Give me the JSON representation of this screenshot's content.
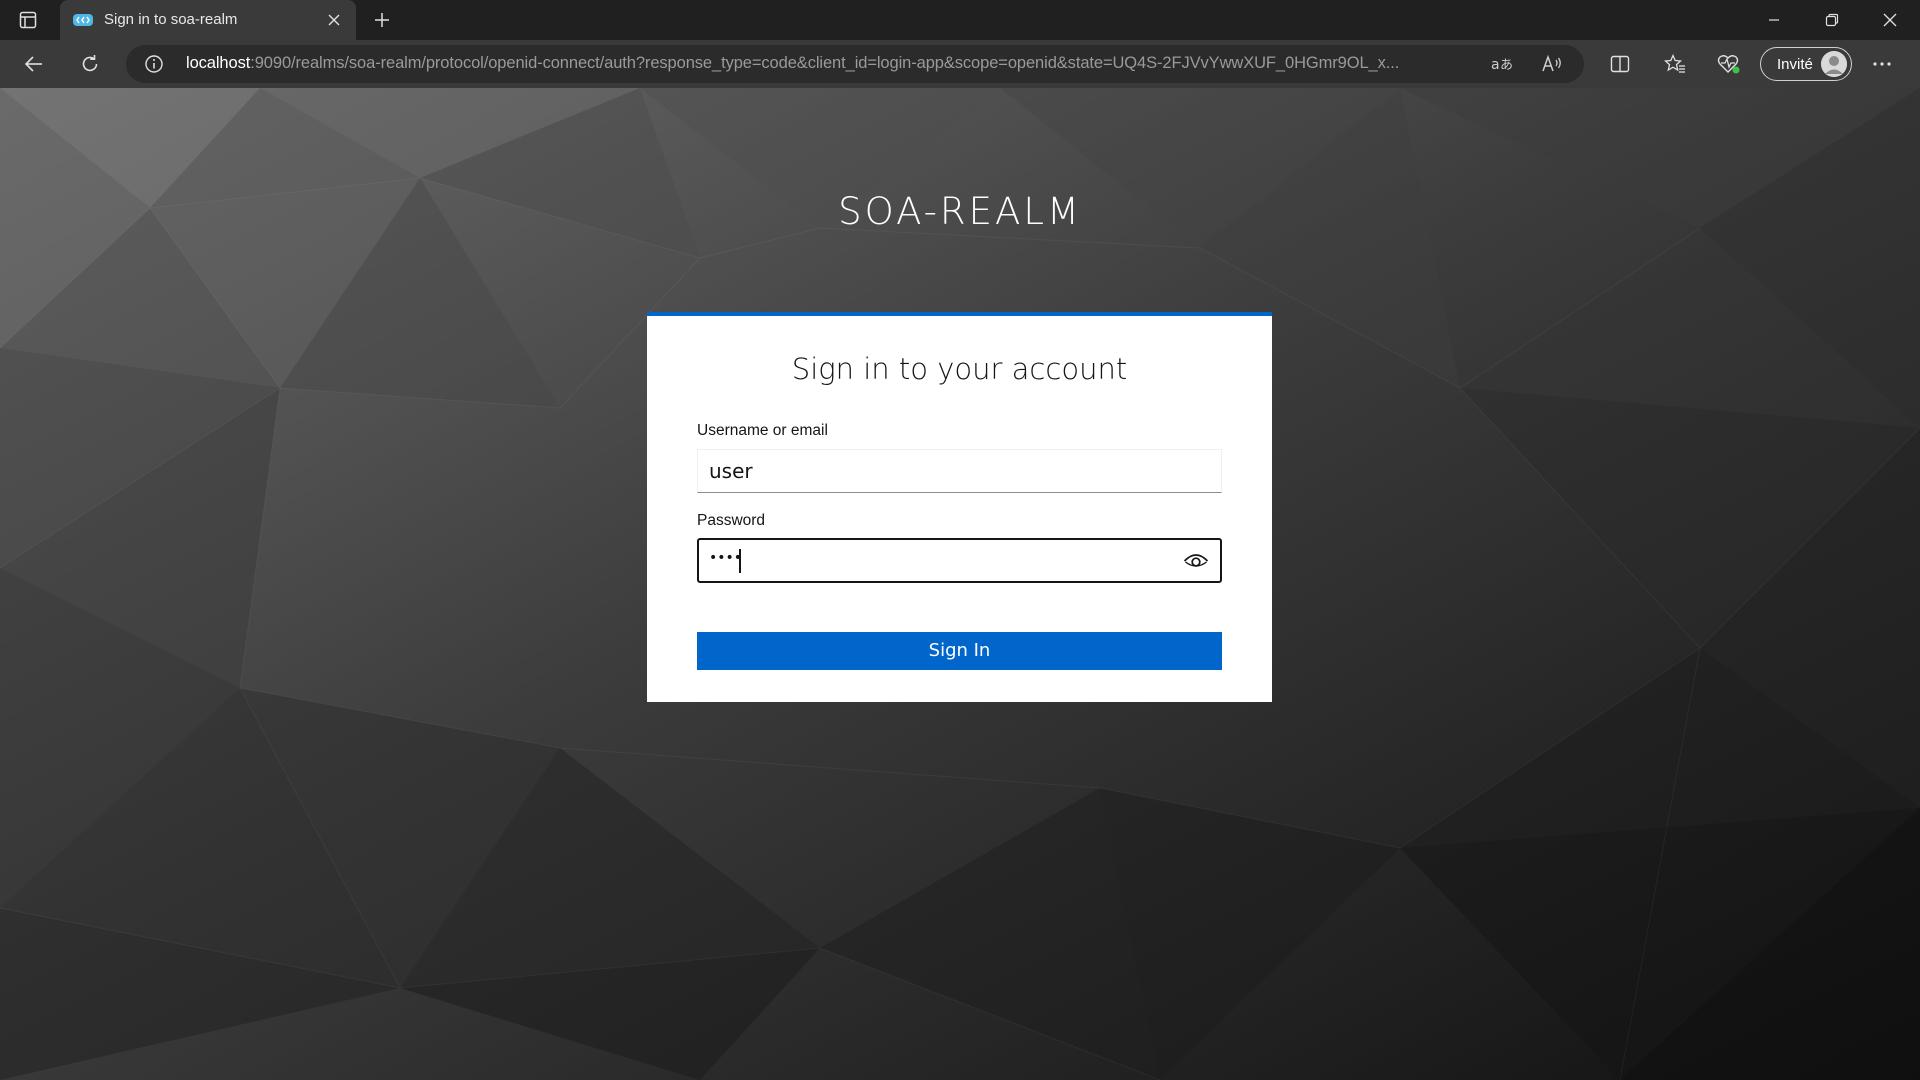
{
  "browser": {
    "tab": {
      "title": "Sign in to soa-realm"
    },
    "address_bar": {
      "url_host": "localhost",
      "url_rest": ":9090/realms/soa-realm/protocol/openid-connect/auth?response_type=code&client_id=login-app&scope=openid&state=UQ4S-2FJVvYwwXUF_0HGmr9OL_x..."
    },
    "profile": {
      "label": "Invité"
    },
    "icons": [
      "tab-actions-icon",
      "browser-favicon",
      "close-icon",
      "plus-icon",
      "minimize-icon",
      "restore-icon",
      "window-close-icon",
      "back-arrow-icon",
      "refresh-icon",
      "info-icon",
      "translate-icon",
      "read-aloud-icon",
      "split-screen-icon",
      "favorites-icon",
      "browser-essentials-icon",
      "avatar-icon",
      "more-icon"
    ]
  },
  "page": {
    "realm_title": "SOA-REALM",
    "card": {
      "heading": "Sign in to your account",
      "username_label": "Username or email",
      "username_value": "user",
      "password_label": "Password",
      "password_mask": "••••",
      "submit_label": "Sign In"
    },
    "colors": {
      "accent": "#0066cc",
      "card_background": "#ffffff",
      "text": "#151515"
    }
  }
}
